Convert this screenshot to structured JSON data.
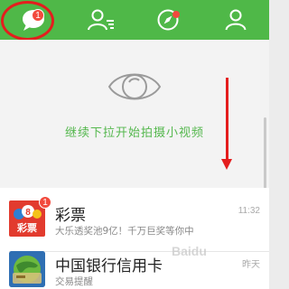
{
  "tabs": [
    {
      "name": "messages",
      "badge": "1"
    },
    {
      "name": "contacts"
    },
    {
      "name": "discover"
    },
    {
      "name": "me"
    }
  ],
  "hint": {
    "text": "继续下拉开始拍摄小视频"
  },
  "chats": [
    {
      "title": "彩票",
      "subtitle": "大乐透奖池9亿！千万巨奖等你中",
      "time": "11:32",
      "badge": "1",
      "avatar_label": "彩票"
    },
    {
      "title": "中国银行信用卡",
      "subtitle": "交易提醒",
      "time": "昨天"
    }
  ],
  "watermark": "Baidu",
  "colors": {
    "brand_green": "#4fb848",
    "badge_red": "#f24a3d",
    "annotation_red": "#e41e1e"
  }
}
